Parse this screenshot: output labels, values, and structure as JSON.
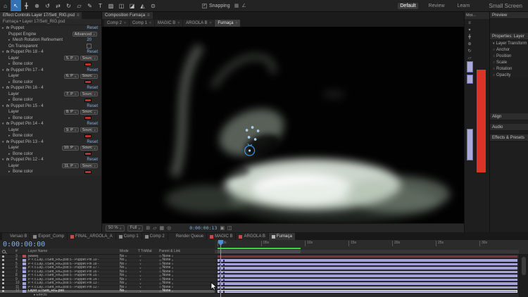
{
  "icons": {
    "panel_menu": "≡",
    "caret": "∨",
    "twirl_open": "▾",
    "twirl_closed": "▸",
    "close": "×",
    "pickwhip": "◎",
    "stopwatch": "○",
    "fx": "fx",
    "check": "✓"
  },
  "colors": {
    "accent_blue": "#3472b5",
    "timecode_blue": "#82b1e8",
    "layer_lavender": "#a2a2d8",
    "maroon_bar": "#7e342b",
    "red_solid": "#d93425"
  },
  "toolbar": {
    "tools": [
      {
        "name": "home",
        "glyph": "⌂"
      },
      {
        "name": "selection",
        "glyph": "↖",
        "active": true
      },
      {
        "name": "hand",
        "glyph": "╋"
      },
      {
        "name": "zoom",
        "glyph": "⊕"
      },
      {
        "name": "orbit",
        "glyph": "↺"
      },
      {
        "name": "pan-camera",
        "glyph": "⇄"
      },
      {
        "name": "rotation",
        "glyph": "↻"
      },
      {
        "name": "shape",
        "glyph": "▱"
      },
      {
        "name": "pen",
        "glyph": "✎"
      },
      {
        "name": "type",
        "glyph": "T"
      },
      {
        "name": "brush",
        "glyph": "▨"
      },
      {
        "name": "clone-stamp",
        "glyph": "◫"
      },
      {
        "name": "eraser",
        "glyph": "◪"
      },
      {
        "name": "roto-brush",
        "glyph": "◭"
      },
      {
        "name": "puppet-pin",
        "glyph": "⊙"
      }
    ],
    "snapping_label": "Snapping",
    "after_snapping_icons": [
      "▦",
      "∠"
    ],
    "workspaces": [
      {
        "label": "Default",
        "active": true
      },
      {
        "label": "Review"
      },
      {
        "label": "Learn"
      }
    ],
    "small_screen": "Small Screen"
  },
  "effect_controls": {
    "tab": "Effect Controls Layer 17/Sett_RIG.psd",
    "breadcrumb": "Furnaça • Layer 17/Sett_RIG.psd",
    "puppet_label": "Puppet",
    "reset_label": "Reset",
    "engine_label": "Puppet Engine",
    "engine_value": "Advanced",
    "mesh_label": "Mesh Rotation Refinement",
    "mesh_value": "20",
    "on_transparent_label": "On Transparent",
    "layer_label": "Layer",
    "source_value": "Sourc",
    "bone_label": "Bone color",
    "pins": [
      {
        "title": "Puppet Pin 18 - 4",
        "layer_value": "5. P"
      },
      {
        "title": "Puppet Pin 17 - 4",
        "layer_value": "6. P"
      },
      {
        "title": "Puppet Pin 16 - 4",
        "layer_value": "7. P"
      },
      {
        "title": "Puppet Pin 15 - 4",
        "layer_value": "8. P"
      },
      {
        "title": "Puppet Pin 14 - 4",
        "layer_value": "9. P"
      },
      {
        "title": "Puppet Pin 13 - 4",
        "layer_value": "10. P"
      },
      {
        "title": "Puppet Pin 12 - 4",
        "layer_value": "11. P"
      }
    ]
  },
  "composition": {
    "panel_tab": "Composition Furnaça",
    "tabs": [
      {
        "label": "Comp 2"
      },
      {
        "label": "Comp 1"
      },
      {
        "label": "MAGIC B"
      },
      {
        "label": "ARGOLA B"
      },
      {
        "label": "Furnaça",
        "active": true
      }
    ],
    "zoom": "50 %",
    "resolution": "Full",
    "timecode": "0:00:00:13",
    "bar_icons_left": [
      "⊞",
      "▱",
      "▦",
      "◎"
    ],
    "bar_icons_right": [
      "▣",
      "◫"
    ]
  },
  "strip": {
    "tab": "Mot...",
    "icons": [
      "≡",
      "▾",
      "╋",
      "⊕",
      "↻",
      "▱",
      "⊙"
    ]
  },
  "right_panels": {
    "preview": "Preview",
    "properties": "Properties: Layer",
    "transform_group": "Layer Transform",
    "props": [
      "Anchor",
      "Position",
      "Scale",
      "Rotation",
      "Opacity"
    ],
    "align": "Align",
    "audio": "Audio",
    "effects_presets": "Effects & Presets"
  },
  "timeline": {
    "tabs": [
      {
        "label": "Versao B",
        "icon": ""
      },
      {
        "label": "Export_Comp",
        "icon": "#8a8a8a"
      },
      {
        "label": "FINAL_ARGOLA_A",
        "icon": "#c34f44"
      },
      {
        "label": "Comp 1",
        "icon": "#8a8a8a"
      },
      {
        "label": "Comp 2",
        "icon": "#8a8a8a"
      },
      {
        "label": "Render Queue",
        "icon": ""
      },
      {
        "label": "MAGIC B",
        "icon": "#c34f44"
      },
      {
        "label": "ARGOLA B",
        "icon": "#c34f44"
      },
      {
        "label": "Furnaça",
        "icon": "#b5b5b5",
        "active": true
      }
    ],
    "timecode": "0:00:00:00",
    "columns": {
      "num": "#",
      "layer_name": "Layer Name",
      "mode": "Mode",
      "trkmat": "T TrkMat",
      "parent": "Parent & Link"
    },
    "ruler_ticks": [
      ":00s",
      "05s",
      "10s",
      "15s",
      "20s",
      "25s",
      "30s"
    ],
    "rows": [
      {
        "num": "3",
        "name": "[wave]",
        "mode": "No",
        "parent": "None",
        "label_color": "#b05050",
        "bar_color": "#7e342b"
      },
      {
        "num": "4",
        "name": "P < c.Lay..7/Sett_RIG.psd 5 - Puppet Pin 19 -",
        "mode": "No",
        "parent": "None",
        "label_color": "#a2a2d8",
        "bar_color": "#a2a2d8",
        "kf": true
      },
      {
        "num": "5",
        "name": "P < c.Lay..7/Sett_RIG.psd 5 - Puppet Pin 18 -",
        "mode": "No",
        "parent": "None",
        "label_color": "#a2a2d8",
        "bar_color": "#a2a2d8",
        "kf": true
      },
      {
        "num": "6",
        "name": "P < c.Lay..7/Sett_RIG.psd 5 - Puppet Pin 17 -",
        "mode": "No",
        "parent": "None",
        "label_color": "#a2a2d8",
        "bar_color": "#a2a2d8",
        "kf": true
      },
      {
        "num": "7",
        "name": "P < c.Lay..7/Sett_RIG.psd 5 - Puppet Pin 16 -",
        "mode": "No",
        "parent": "None",
        "label_color": "#a2a2d8",
        "bar_color": "#a2a2d8",
        "kf": true
      },
      {
        "num": "8",
        "name": "P < c.Lay..7/Sett_RIG.psd 5 - Puppet Pin 15 -",
        "mode": "No",
        "parent": "None",
        "label_color": "#a2a2d8",
        "bar_color": "#a2a2d8",
        "kf": true
      },
      {
        "num": "9",
        "name": "P < c.Lay..7/Sett_RIG.psd 5 - Puppet Pin 14 -",
        "mode": "No",
        "parent": "None",
        "label_color": "#a2a2d8",
        "bar_color": "#a2a2d8",
        "kf": true
      },
      {
        "num": "10",
        "name": "P < c.Lay..7/Sett_RIG.psd 5 - Puppet Pin 13 -",
        "mode": "No",
        "parent": "None",
        "label_color": "#a2a2d8",
        "bar_color": "#a2a2d8",
        "kf": true
      },
      {
        "num": "11",
        "name": "P < c.Lay..7/Sett_RIG.psd 5 - Puppet Pin 12 -",
        "mode": "No",
        "parent": "None",
        "label_color": "#a2a2d8",
        "bar_color": "#a2a2d8",
        "kf": true
      },
      {
        "num": "12",
        "name": "Layer 17/Sett_RIG.psd",
        "mode": "No",
        "parent": "None",
        "label_color": "#a2a2d8",
        "bar_color": "#9a9ad0",
        "selected": true,
        "kf": true
      },
      {
        "num": "",
        "name": "Effects",
        "child": true
      }
    ]
  }
}
